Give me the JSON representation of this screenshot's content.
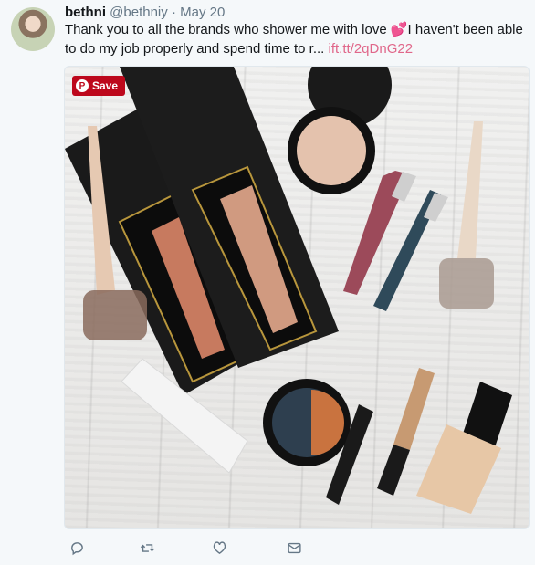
{
  "tweet": {
    "display_name": "bethni",
    "handle": "@bethniy",
    "separator": "·",
    "date": "May 20",
    "text": "Thank you to all the brands who shower me with love ",
    "emoji": "💕",
    "text_continued": "I haven't been able to do my job properly and spend time to r... ",
    "link": "ift.tt/2qDnG22"
  },
  "media": {
    "save_label": "Save",
    "pin_glyph": "P"
  },
  "actions": {
    "icons": [
      "reply-icon",
      "retweet-icon",
      "like-icon",
      "message-icon"
    ]
  },
  "colors": {
    "link": "#e0678a",
    "save_bg": "#bd081c",
    "muted": "#657786"
  }
}
